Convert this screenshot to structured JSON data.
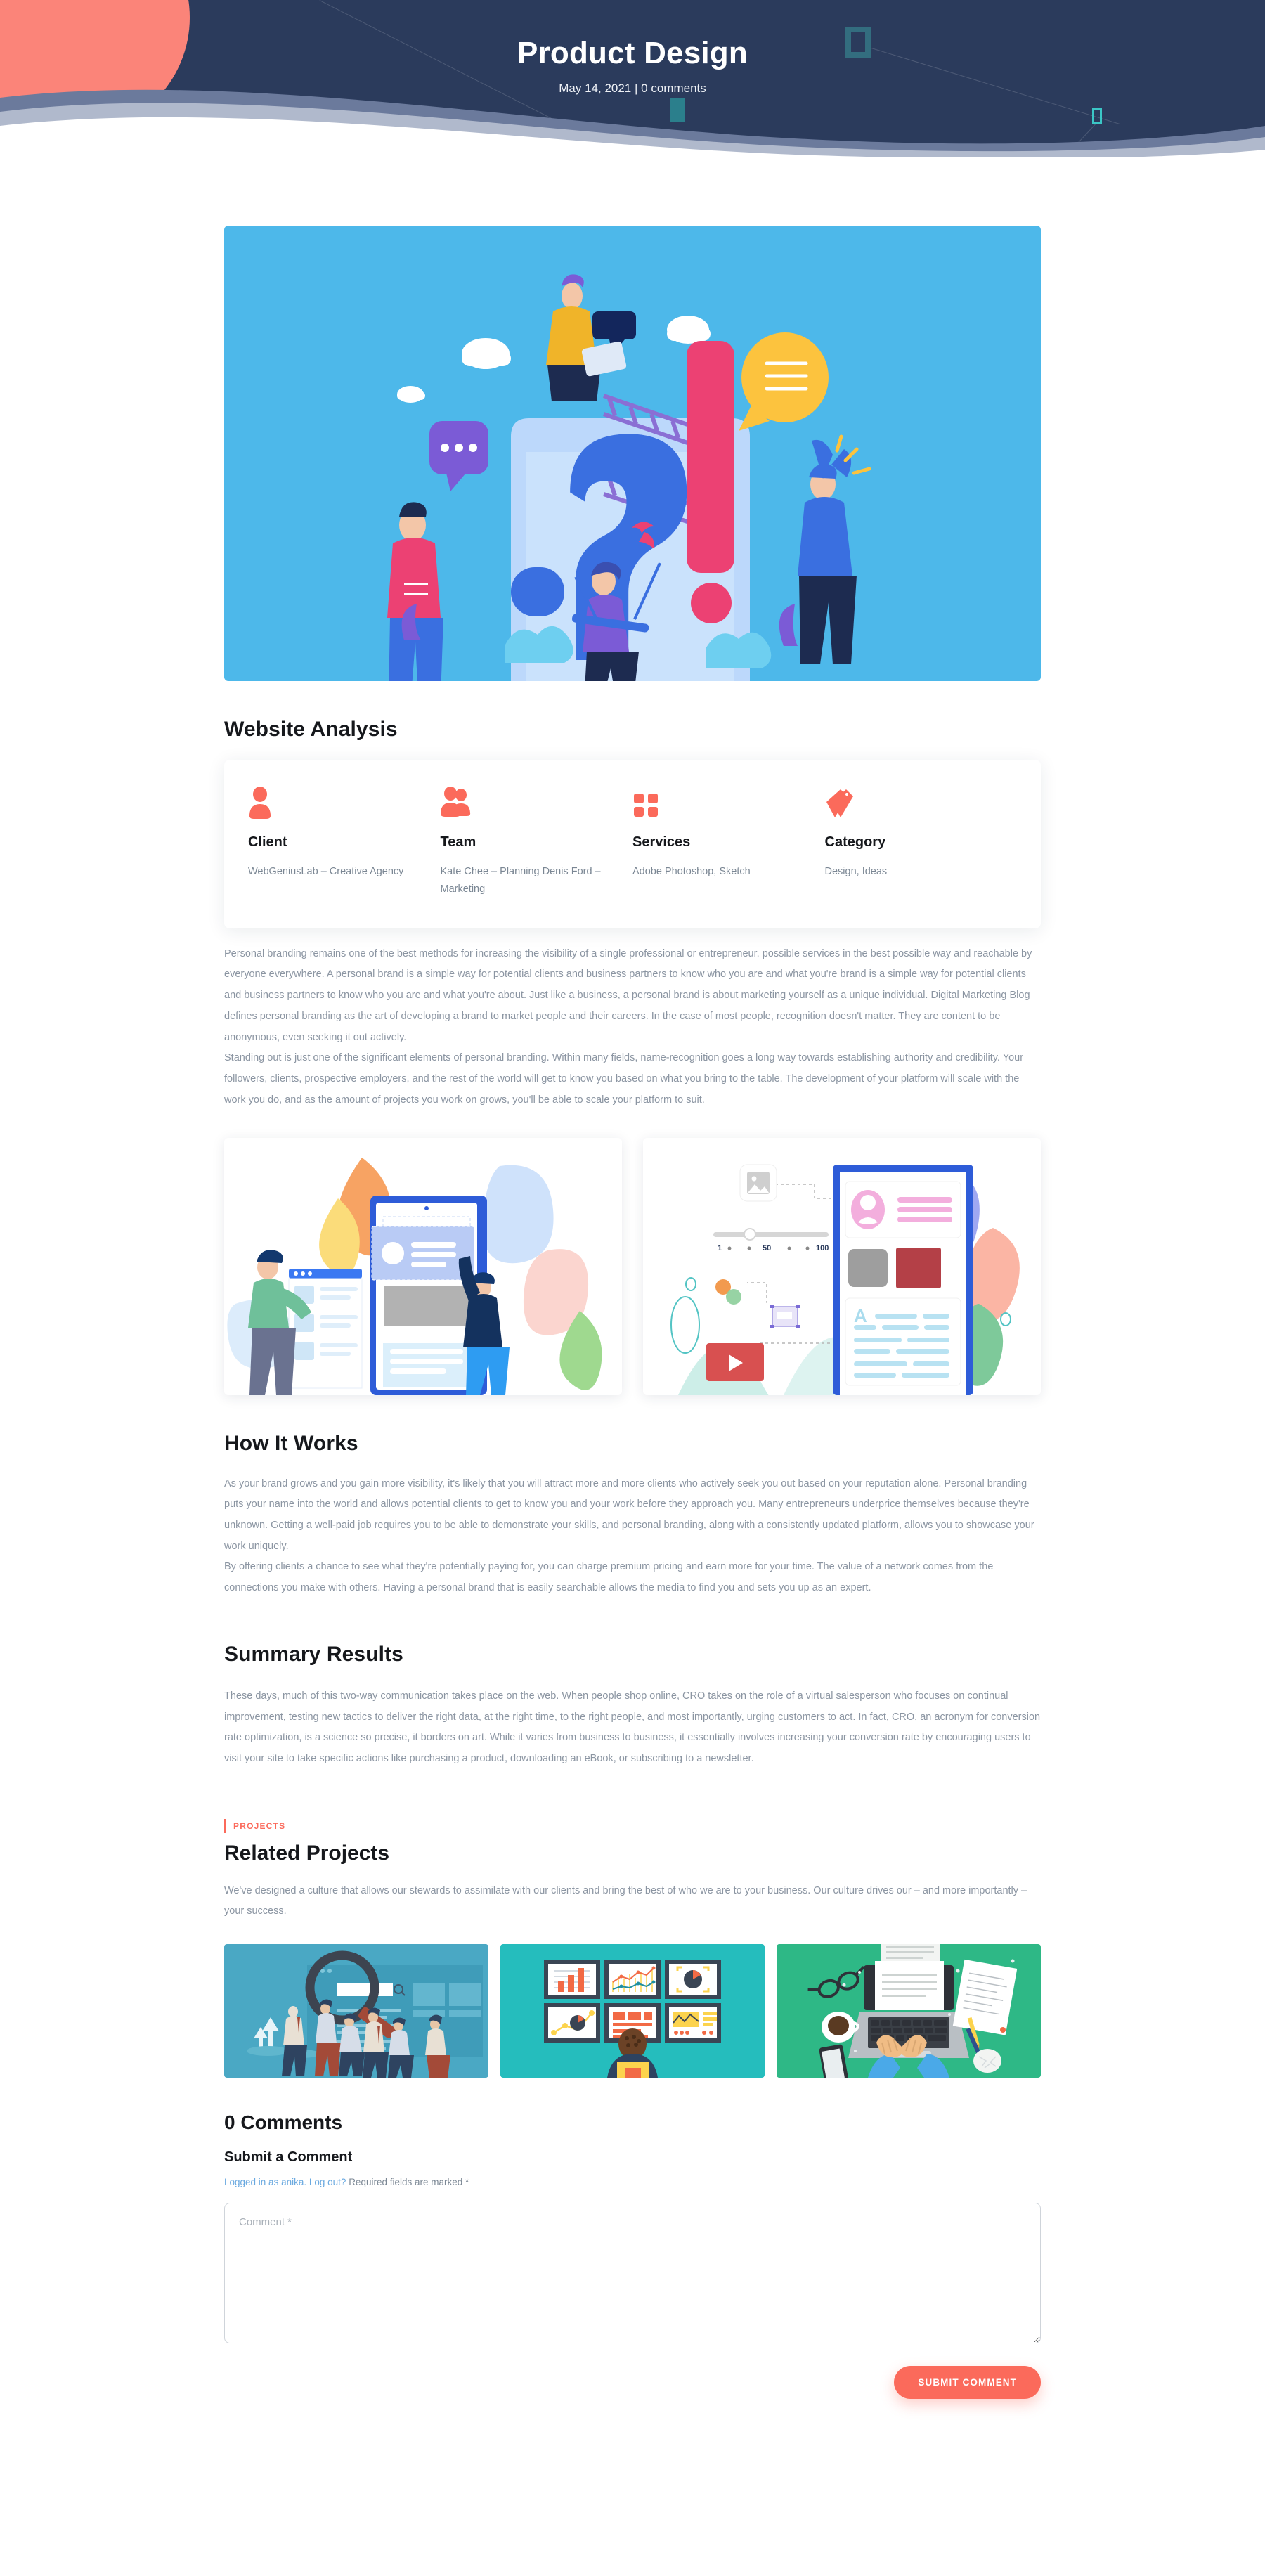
{
  "hero": {
    "title": "Product Design",
    "date": "May 14, 2021",
    "separator": "|",
    "comments": "0 comments",
    "bg_color": "#2b3b5c",
    "accent_color": "#fb8479"
  },
  "featured_image": {
    "alt": "Question mark and exclamation mark illustration with people",
    "bg_color": "#4db8ea"
  },
  "website_analysis": {
    "heading": "Website Analysis",
    "items": [
      {
        "icon": "user-icon",
        "label": "Client",
        "value": "WebGeniusLab – Creative Agency"
      },
      {
        "icon": "users-icon",
        "label": "Team",
        "value": "Kate Chee – Planning Denis Ford – Marketing"
      },
      {
        "icon": "grid-icon",
        "label": "Services",
        "value": "Adobe Photoshop, Sketch"
      },
      {
        "icon": "tag-icon",
        "label": "Category",
        "value": "Design, Ideas"
      }
    ],
    "icon_color": "#fb6a5b"
  },
  "intro": {
    "paragraph_1": "Personal branding remains one of the best methods for increasing the visibility of a single professional or entrepreneur. possible services in the best possible way and reachable by everyone everywhere. A personal brand is a simple way for potential clients and business partners to know who you are and what you're brand is a simple way for potential clients and business partners to know who you are and what you're about. Just like a business, a personal brand is about marketing yourself as a unique individual. Digital Marketing Blog defines personal branding as the art of developing a brand to market people and their careers. In the case of most people, recognition doesn't matter. They are content to be anonymous, even seeking it out actively.",
    "paragraph_2": "Standing out is just one of the significant elements of personal branding. Within many fields, name-recognition goes a long way towards establishing authority and credibility. Your followers, clients, prospective employers, and the rest of the world will get to know you based on what you bring to the table. The development of your platform will scale with the work you do, and as the amount of projects you work on grows, you'll be able to scale your platform to suit."
  },
  "twin_images": [
    {
      "alt": "Two people building a mobile app layout",
      "bg_color": "#ffffff"
    },
    {
      "alt": "Design tools and mobile content editor",
      "bg_color": "#ffffff"
    }
  ],
  "how_it_works": {
    "heading": "How It Works",
    "paragraph_1": "As your brand grows and you gain more visibility, it's likely that you will attract more and more clients who actively seek you out based on your reputation alone. Personal branding puts your name into the world and allows potential clients to get to know you and your work before they approach you. Many entrepreneurs underprice themselves because they're unknown. Getting a well-paid job requires you to be able to demonstrate your skills, and personal branding, along with a consistently updated platform, allows you to showcase your work uniquely.",
    "paragraph_2": "By offering clients a chance to see what they're potentially paying for, you can charge premium pricing and earn more for your time. The value of a network comes from the connections you make with others. Having a personal brand that is easily searchable allows the media to find you and sets you up as an expert."
  },
  "summary_results": {
    "heading": "Summary Results",
    "paragraph_1": "These days, much of this two-way communication takes place on the web. When people shop online, CRO takes on the role of a virtual salesperson who focuses on continual improvement, testing new tactics to deliver the right data, at the right time, to the right people, and most importantly, urging customers to act. In fact, CRO, an acronym for conversion rate optimization, is a science so precise, it borders on art. While it varies from business to business, it essentially involves increasing your conversion rate by encouraging users to visit your site to take specific actions like purchasing a product, downloading an eBook, or subscribing to a newsletter."
  },
  "related_projects": {
    "eyebrow": "PROJECTS",
    "heading": "Related Projects",
    "description": "We've designed a culture that allows our stewards to assimilate with our clients and bring the best of who we are to your business. Our culture drives our – and more importantly – your success.",
    "cards": [
      {
        "alt": "Team holding a giant magnifying glass over a search bar",
        "bg_color": "#4aa8c4"
      },
      {
        "alt": "Person viewing a wall of analytics dashboards",
        "bg_color": "#25bdbd"
      },
      {
        "alt": "Top-down desk with laptop, coffee and notes",
        "bg_color": "#2eb886"
      }
    ]
  },
  "comments_section": {
    "count_heading": "0 Comments",
    "submit_heading": "Submit a Comment",
    "logged_in_prefix": "Logged in as anika.",
    "logout_label": "Log out?",
    "required_note": "Required fields are marked *",
    "comment_placeholder": "Comment *",
    "comment_value": "",
    "submit_label": "SUBMIT COMMENT",
    "button_color": "#fb6a5b"
  }
}
